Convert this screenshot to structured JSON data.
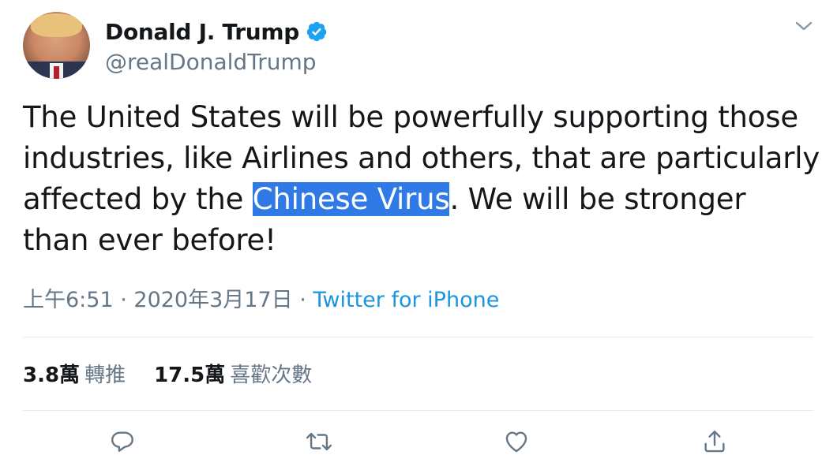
{
  "author": {
    "display_name": "Donald J. Trump",
    "handle": "@realDonaldTrump",
    "verified": true,
    "avatar_alt": "profile-photo"
  },
  "tweet": {
    "text_before": "The United States will be powerfully supporting those industries, like Airlines and others, that are particularly affected by the ",
    "highlighted": "Chinese Virus",
    "text_after": ". We will be stronger than ever before!",
    "highlight_color": "#2f7ae5"
  },
  "meta": {
    "time": "上午6:51",
    "separator": " · ",
    "date": "2020年3月17日",
    "source": "Twitter for iPhone"
  },
  "stats": {
    "retweets_count": "3.8萬",
    "retweets_label": "轉推",
    "likes_count": "17.5萬",
    "likes_label": "喜歡次數"
  },
  "icons": {
    "caret": "chevron-down-icon",
    "reply": "reply-icon",
    "retweet": "retweet-icon",
    "like": "heart-icon",
    "share": "share-icon",
    "verified": "verified-badge-icon"
  },
  "colors": {
    "text": "#14171a",
    "secondary": "#657786",
    "link": "#1b95e0",
    "verified": "#1da1f2"
  }
}
